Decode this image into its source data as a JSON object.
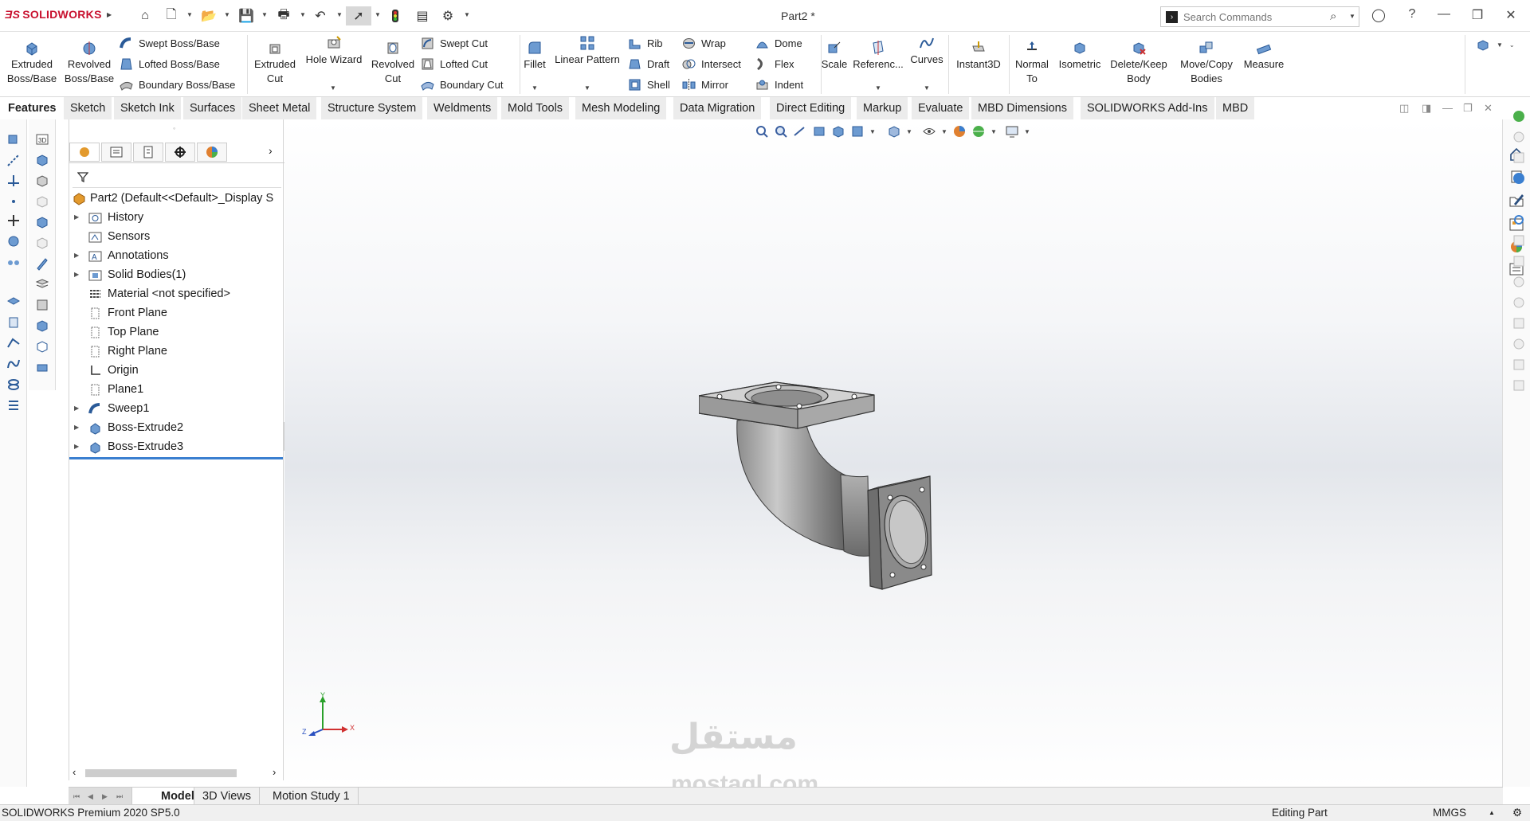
{
  "app": {
    "logo": "SOLIDWORKS",
    "window_title": "Part2 *"
  },
  "search": {
    "placeholder": "Search Commands"
  },
  "ribbon": {
    "extruded_boss": "Extruded Boss/Base",
    "revolved_boss": "Revolved Boss/Base",
    "swept_boss": "Swept Boss/Base",
    "lofted_boss": "Lofted Boss/Base",
    "boundary_boss": "Boundary Boss/Base",
    "extruded_cut": "Extruded Cut",
    "hole_wizard": "Hole Wizard",
    "revolved_cut": "Revolved Cut",
    "swept_cut": "Swept Cut",
    "lofted_cut": "Lofted Cut",
    "boundary_cut": "Boundary Cut",
    "fillet": "Fillet",
    "linear_pattern": "Linear Pattern",
    "rib": "Rib",
    "draft": "Draft",
    "shell": "Shell",
    "wrap": "Wrap",
    "intersect": "Intersect",
    "mirror": "Mirror",
    "dome": "Dome",
    "flex": "Flex",
    "indent": "Indent",
    "scale": "Scale",
    "reference": "Referenc...",
    "curves": "Curves",
    "instant3d": "Instant3D",
    "normal_to": "Normal To",
    "isometric": "Isometric",
    "delete_keep": "Delete/Keep Body",
    "move_copy": "Move/Copy Bodies",
    "measure": "Measure"
  },
  "tabs": [
    "Features",
    "Sketch",
    "Sketch Ink",
    "Surfaces",
    "Sheet Metal",
    "Structure System",
    "Weldments",
    "Mold Tools",
    "Mesh Modeling",
    "Data Migration",
    "Direct Editing",
    "Markup",
    "Evaluate",
    "MBD Dimensions",
    "SOLIDWORKS Add-Ins",
    "MBD"
  ],
  "tree": {
    "root": "Part2  (Default<<Default>_Display S",
    "items": [
      "History",
      "Sensors",
      "Annotations",
      "Solid Bodies(1)",
      "Material <not specified>",
      "Front Plane",
      "Top Plane",
      "Right Plane",
      "Origin",
      "Plane1",
      "Sweep1",
      "Boss-Extrude2",
      "Boss-Extrude3"
    ]
  },
  "triad": {
    "x": "X",
    "y": "Y",
    "z": "Z"
  },
  "bottom_tabs": [
    "Model",
    "3D Views",
    "Motion Study 1"
  ],
  "status": {
    "version": "SOLIDWORKS Premium 2020 SP5.0",
    "mode": "Editing Part",
    "units": "MMGS"
  },
  "watermark": {
    "arabic": "مستقل",
    "latin": "mostaql.com"
  },
  "colors": {
    "brand": "#c8102e",
    "accent": "#1f5fad",
    "part_gray": "#9a9a9a"
  }
}
